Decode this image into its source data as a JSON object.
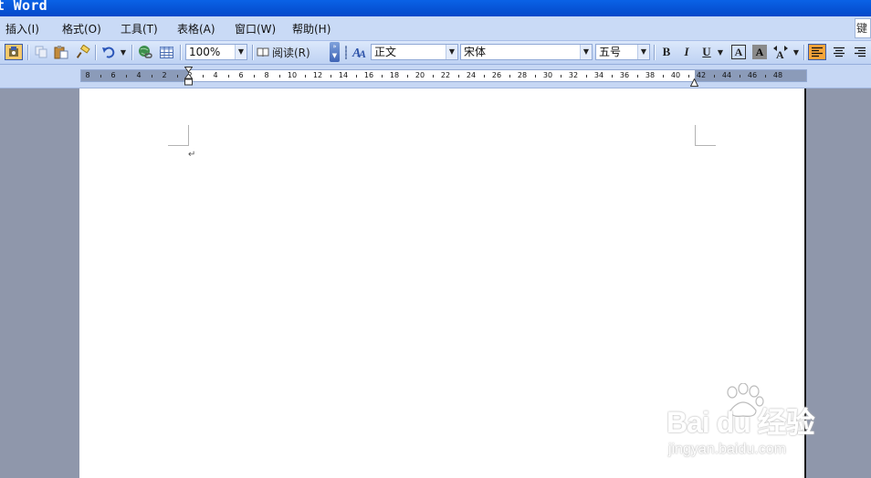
{
  "window": {
    "title_fragment": "t Word"
  },
  "menubar": {
    "items": [
      {
        "label": "插入(I)"
      },
      {
        "label": "格式(O)"
      },
      {
        "label": "工具(T)"
      },
      {
        "label": "表格(A)"
      },
      {
        "label": "窗口(W)"
      },
      {
        "label": "帮助(H)"
      }
    ],
    "ask_box_text": "键"
  },
  "toolbar": {
    "icons": [
      "research-icon",
      "copy-icon",
      "paste-icon",
      "format-painter-icon",
      "undo-icon",
      "hyperlink-icon",
      "table-icon",
      "read-mode-icon",
      "styles-icon"
    ],
    "zoom_value": "100%",
    "read_label": "阅读(R)",
    "style_value": "正文",
    "font_value": "宋体",
    "size_value": "五号",
    "bold_label": "B",
    "italic_label": "I",
    "underline_label": "U",
    "border_label": "A",
    "shade_label": "A",
    "accent_color": "#f7a53a"
  },
  "ruler": {
    "labels": [
      "8",
      "6",
      "4",
      "2",
      "2",
      "4",
      "6",
      "8",
      "10",
      "12",
      "14",
      "16",
      "18",
      "20",
      "22",
      "24",
      "26",
      "28",
      "30",
      "32",
      "34",
      "36",
      "38",
      "40",
      "42",
      "44",
      "46",
      "48"
    ]
  },
  "document": {
    "paragraph_mark": "↵"
  },
  "watermark": {
    "brand": "Bai du 经验",
    "url": "jingyan.baidu.com"
  }
}
